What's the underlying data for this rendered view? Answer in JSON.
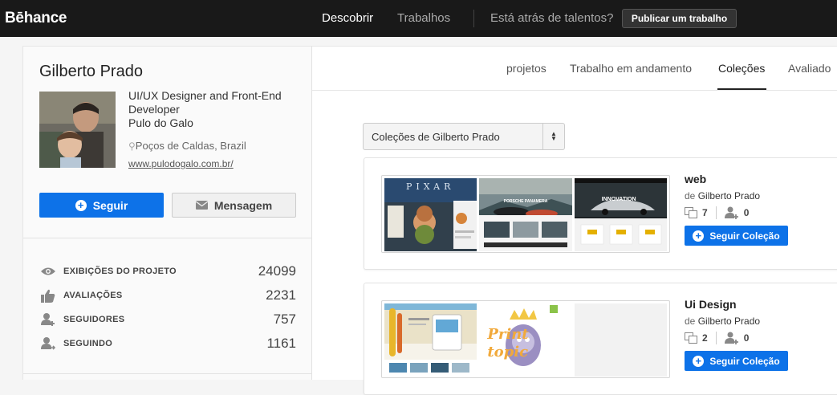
{
  "topbar": {
    "logo": "Bēhance",
    "nav_discover": "Descobrir",
    "nav_jobs": "Trabalhos",
    "nav_talent": "Está atrás de talentos?",
    "publish_button": "Publicar um trabalho"
  },
  "profile": {
    "name": "Gilberto Prado",
    "title": "UI/UX Designer and Front-End Developer",
    "company": "Pulo do Galo",
    "location": "Poços de Caldas, Brazil",
    "website": "www.pulodogalo.com.br/",
    "follow_button": "Seguir",
    "message_button": "Mensagem",
    "stats": [
      {
        "icon": "eye-icon",
        "label": "EXIBIÇÕES DO PROJETO",
        "value": "24099"
      },
      {
        "icon": "thumbs-up-icon",
        "label": "AVALIAÇÕES",
        "value": "2231"
      },
      {
        "icon": "followers-icon",
        "label": "SEGUIDORES",
        "value": "757"
      },
      {
        "icon": "following-icon",
        "label": "SEGUINDO",
        "value": "1161"
      }
    ]
  },
  "tabs": [
    "projetos",
    "Trabalho em andamento",
    "Coleções",
    "Avaliado"
  ],
  "active_tab": "Coleções",
  "collection_select": "Coleções de Gilberto Prado",
  "collections": [
    {
      "title": "web",
      "by_prefix": "de",
      "author": "Gilberto Prado",
      "projects": "7",
      "followers": "0",
      "follow_button": "Seguir Coleção"
    },
    {
      "title": "Ui Design",
      "by_prefix": "de",
      "author": "Gilberto Prado",
      "projects": "2",
      "followers": "0",
      "follow_button": "Seguir Coleção"
    }
  ],
  "thumb_texts": {
    "pixar": "PIXAR",
    "innovation": "INNOVATION",
    "print_topic": "Print topic"
  },
  "colors": {
    "brand_blue": "#0d72e8",
    "topbar_bg": "#191919"
  }
}
